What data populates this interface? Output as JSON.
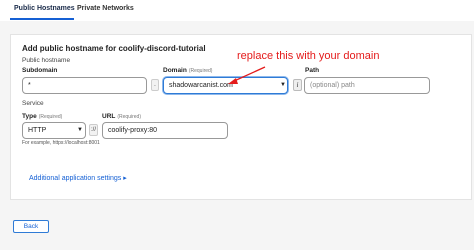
{
  "tabs": [
    {
      "label": "Public Hostnames",
      "active": true
    },
    {
      "label": "Private Networks",
      "active": false
    }
  ],
  "form": {
    "title": "Add public hostname for coolify-discord-tutorial",
    "section_public": "Public hostname",
    "subdomain": {
      "label": "Subdomain",
      "value": "*"
    },
    "domain": {
      "label": "Domain",
      "required": "(Required)",
      "value": "shadowarcanist.com"
    },
    "path": {
      "label": "Path",
      "placeholder": "(optional) path"
    },
    "separator_dot": ".",
    "separator_slash": "/",
    "section_service": "Service",
    "type": {
      "label": "Type",
      "required": "(Required)",
      "value": "HTTP"
    },
    "url": {
      "label": "URL",
      "required": "(Required)",
      "value": "coolify-proxy:80"
    },
    "separator_scheme": "://",
    "hint": "For example, https://localhost:8001",
    "additional_settings": "Additional application settings"
  },
  "annotation": {
    "text": "replace this with your domain",
    "color": "#e41b1b"
  },
  "footer": {
    "back_label": "Back"
  },
  "colors": {
    "accent": "#1560d4",
    "focus_border": "#2f7bd6"
  },
  "icons": [
    "chevron-down-icon",
    "info-icon",
    "caret-right-icon",
    "arrow-annotation"
  ]
}
